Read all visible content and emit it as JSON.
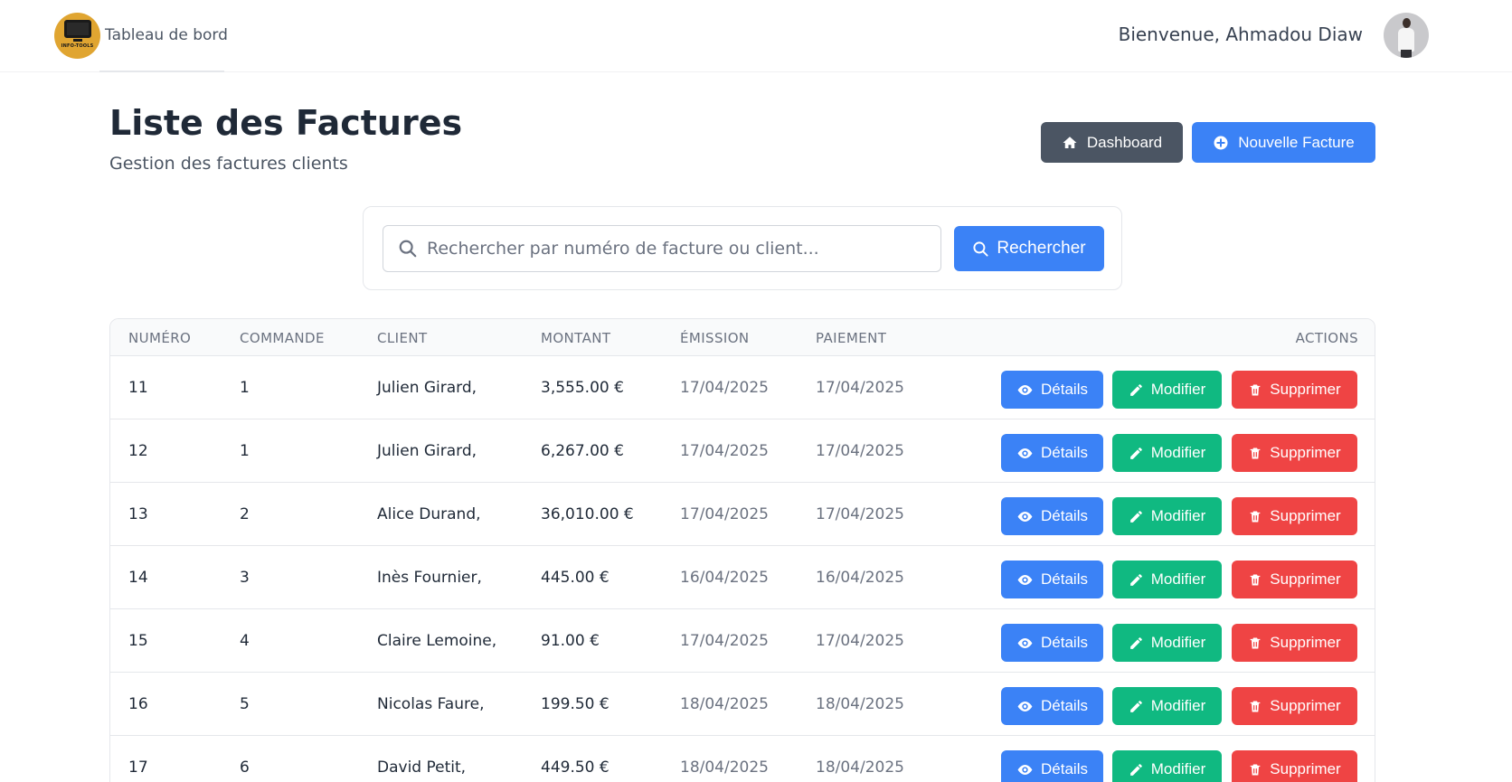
{
  "navbar": {
    "logo_text": "INFO-TOOLS",
    "brand_link": "Tableau de bord",
    "welcome": "Bienvenue, Ahmadou Diaw"
  },
  "header": {
    "title": "Liste des Factures",
    "subtitle": "Gestion des factures clients",
    "dashboard_button": "Dashboard",
    "new_invoice_button": "Nouvelle Facture"
  },
  "search": {
    "placeholder": "Rechercher par numéro de facture ou client...",
    "value": "",
    "button": "Rechercher"
  },
  "table": {
    "columns": [
      "NUMÉRO",
      "COMMANDE",
      "CLIENT",
      "MONTANT",
      "ÉMISSION",
      "PAIEMENT",
      "ACTIONS"
    ],
    "action_labels": {
      "details": "Détails",
      "edit": "Modifier",
      "delete": "Supprimer"
    },
    "rows": [
      {
        "numero": "11",
        "commande": "1",
        "client": "Julien Girard,",
        "montant": "3,555.00 €",
        "emission": "17/04/2025",
        "paiement": "17/04/2025"
      },
      {
        "numero": "12",
        "commande": "1",
        "client": "Julien Girard,",
        "montant": "6,267.00 €",
        "emission": "17/04/2025",
        "paiement": "17/04/2025"
      },
      {
        "numero": "13",
        "commande": "2",
        "client": "Alice Durand,",
        "montant": "36,010.00 €",
        "emission": "17/04/2025",
        "paiement": "17/04/2025"
      },
      {
        "numero": "14",
        "commande": "3",
        "client": "Inès Fournier,",
        "montant": "445.00 €",
        "emission": "16/04/2025",
        "paiement": "16/04/2025"
      },
      {
        "numero": "15",
        "commande": "4",
        "client": "Claire Lemoine,",
        "montant": "91.00 €",
        "emission": "17/04/2025",
        "paiement": "17/04/2025"
      },
      {
        "numero": "16",
        "commande": "5",
        "client": "Nicolas Faure,",
        "montant": "199.50 €",
        "emission": "18/04/2025",
        "paiement": "18/04/2025"
      },
      {
        "numero": "17",
        "commande": "6",
        "client": "David Petit,",
        "montant": "449.50 €",
        "emission": "18/04/2025",
        "paiement": "18/04/2025"
      }
    ]
  },
  "colors": {
    "primary": "#3b82f6",
    "secondary": "#4b5563",
    "success": "#10b981",
    "danger": "#ef4444",
    "logo": "#e0a531"
  }
}
